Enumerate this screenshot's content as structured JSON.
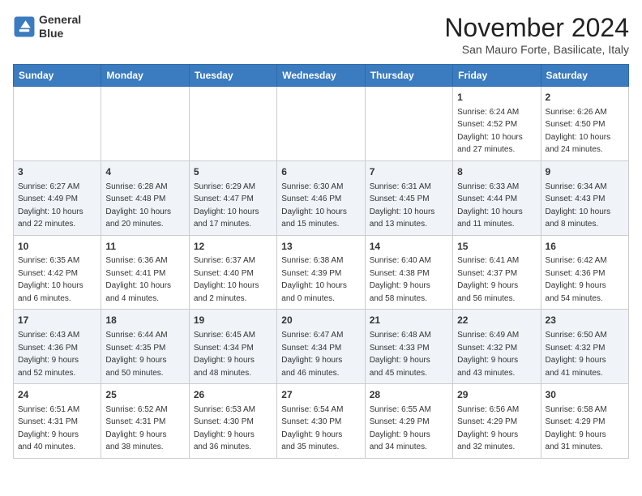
{
  "header": {
    "logo_line1": "General",
    "logo_line2": "Blue",
    "month": "November 2024",
    "location": "San Mauro Forte, Basilicate, Italy"
  },
  "weekdays": [
    "Sunday",
    "Monday",
    "Tuesday",
    "Wednesday",
    "Thursday",
    "Friday",
    "Saturday"
  ],
  "weeks": [
    [
      {
        "day": "",
        "info": ""
      },
      {
        "day": "",
        "info": ""
      },
      {
        "day": "",
        "info": ""
      },
      {
        "day": "",
        "info": ""
      },
      {
        "day": "",
        "info": ""
      },
      {
        "day": "1",
        "info": "Sunrise: 6:24 AM\nSunset: 4:52 PM\nDaylight: 10 hours\nand 27 minutes."
      },
      {
        "day": "2",
        "info": "Sunrise: 6:26 AM\nSunset: 4:50 PM\nDaylight: 10 hours\nand 24 minutes."
      }
    ],
    [
      {
        "day": "3",
        "info": "Sunrise: 6:27 AM\nSunset: 4:49 PM\nDaylight: 10 hours\nand 22 minutes."
      },
      {
        "day": "4",
        "info": "Sunrise: 6:28 AM\nSunset: 4:48 PM\nDaylight: 10 hours\nand 20 minutes."
      },
      {
        "day": "5",
        "info": "Sunrise: 6:29 AM\nSunset: 4:47 PM\nDaylight: 10 hours\nand 17 minutes."
      },
      {
        "day": "6",
        "info": "Sunrise: 6:30 AM\nSunset: 4:46 PM\nDaylight: 10 hours\nand 15 minutes."
      },
      {
        "day": "7",
        "info": "Sunrise: 6:31 AM\nSunset: 4:45 PM\nDaylight: 10 hours\nand 13 minutes."
      },
      {
        "day": "8",
        "info": "Sunrise: 6:33 AM\nSunset: 4:44 PM\nDaylight: 10 hours\nand 11 minutes."
      },
      {
        "day": "9",
        "info": "Sunrise: 6:34 AM\nSunset: 4:43 PM\nDaylight: 10 hours\nand 8 minutes."
      }
    ],
    [
      {
        "day": "10",
        "info": "Sunrise: 6:35 AM\nSunset: 4:42 PM\nDaylight: 10 hours\nand 6 minutes."
      },
      {
        "day": "11",
        "info": "Sunrise: 6:36 AM\nSunset: 4:41 PM\nDaylight: 10 hours\nand 4 minutes."
      },
      {
        "day": "12",
        "info": "Sunrise: 6:37 AM\nSunset: 4:40 PM\nDaylight: 10 hours\nand 2 minutes."
      },
      {
        "day": "13",
        "info": "Sunrise: 6:38 AM\nSunset: 4:39 PM\nDaylight: 10 hours\nand 0 minutes."
      },
      {
        "day": "14",
        "info": "Sunrise: 6:40 AM\nSunset: 4:38 PM\nDaylight: 9 hours\nand 58 minutes."
      },
      {
        "day": "15",
        "info": "Sunrise: 6:41 AM\nSunset: 4:37 PM\nDaylight: 9 hours\nand 56 minutes."
      },
      {
        "day": "16",
        "info": "Sunrise: 6:42 AM\nSunset: 4:36 PM\nDaylight: 9 hours\nand 54 minutes."
      }
    ],
    [
      {
        "day": "17",
        "info": "Sunrise: 6:43 AM\nSunset: 4:36 PM\nDaylight: 9 hours\nand 52 minutes."
      },
      {
        "day": "18",
        "info": "Sunrise: 6:44 AM\nSunset: 4:35 PM\nDaylight: 9 hours\nand 50 minutes."
      },
      {
        "day": "19",
        "info": "Sunrise: 6:45 AM\nSunset: 4:34 PM\nDaylight: 9 hours\nand 48 minutes."
      },
      {
        "day": "20",
        "info": "Sunrise: 6:47 AM\nSunset: 4:34 PM\nDaylight: 9 hours\nand 46 minutes."
      },
      {
        "day": "21",
        "info": "Sunrise: 6:48 AM\nSunset: 4:33 PM\nDaylight: 9 hours\nand 45 minutes."
      },
      {
        "day": "22",
        "info": "Sunrise: 6:49 AM\nSunset: 4:32 PM\nDaylight: 9 hours\nand 43 minutes."
      },
      {
        "day": "23",
        "info": "Sunrise: 6:50 AM\nSunset: 4:32 PM\nDaylight: 9 hours\nand 41 minutes."
      }
    ],
    [
      {
        "day": "24",
        "info": "Sunrise: 6:51 AM\nSunset: 4:31 PM\nDaylight: 9 hours\nand 40 minutes."
      },
      {
        "day": "25",
        "info": "Sunrise: 6:52 AM\nSunset: 4:31 PM\nDaylight: 9 hours\nand 38 minutes."
      },
      {
        "day": "26",
        "info": "Sunrise: 6:53 AM\nSunset: 4:30 PM\nDaylight: 9 hours\nand 36 minutes."
      },
      {
        "day": "27",
        "info": "Sunrise: 6:54 AM\nSunset: 4:30 PM\nDaylight: 9 hours\nand 35 minutes."
      },
      {
        "day": "28",
        "info": "Sunrise: 6:55 AM\nSunset: 4:29 PM\nDaylight: 9 hours\nand 34 minutes."
      },
      {
        "day": "29",
        "info": "Sunrise: 6:56 AM\nSunset: 4:29 PM\nDaylight: 9 hours\nand 32 minutes."
      },
      {
        "day": "30",
        "info": "Sunrise: 6:58 AM\nSunset: 4:29 PM\nDaylight: 9 hours\nand 31 minutes."
      }
    ]
  ]
}
